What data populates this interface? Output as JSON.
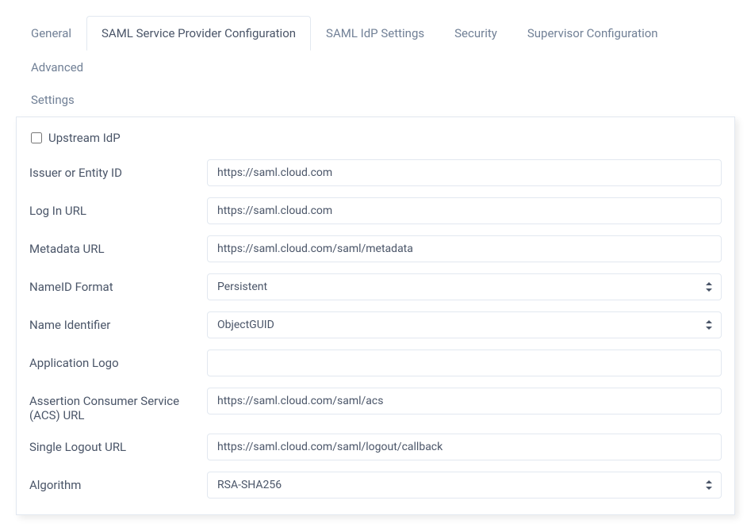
{
  "tabs": {
    "general": "General",
    "saml_sp": "SAML Service Provider Configuration",
    "saml_idp": "SAML IdP Settings",
    "security": "Security",
    "supervisor": "Supervisor Configuration",
    "advanced": "Advanced",
    "settings": "Settings"
  },
  "form": {
    "upstream_idp_label": "Upstream IdP",
    "issuer_label": "Issuer or Entity ID",
    "issuer_value": "https://saml.cloud.com",
    "login_url_label": "Log In URL",
    "login_url_value": "https://saml.cloud.com",
    "metadata_url_label": "Metadata URL",
    "metadata_url_value": "https://saml.cloud.com/saml/metadata",
    "nameid_format_label": "NameID Format",
    "nameid_format_value": "Persistent",
    "name_identifier_label": "Name Identifier",
    "name_identifier_value": "ObjectGUID",
    "app_logo_label": "Application Logo",
    "app_logo_value": "",
    "acs_url_label": "Assertion Consumer Service (ACS) URL",
    "acs_url_value": "https://saml.cloud.com/saml/acs",
    "slo_url_label": "Single Logout URL",
    "slo_url_value": "https://saml.cloud.com/saml/logout/callback",
    "algorithm_label": "Algorithm",
    "algorithm_value": "RSA-SHA256"
  }
}
